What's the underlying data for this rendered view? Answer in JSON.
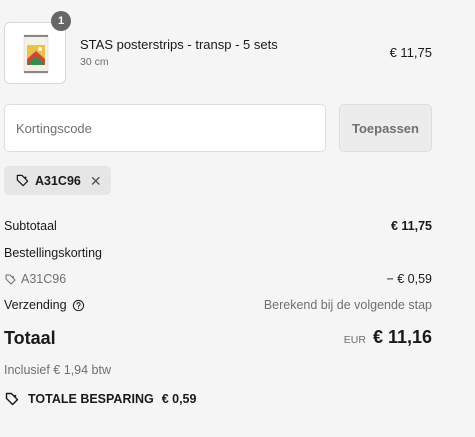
{
  "cart": {
    "item": {
      "quantity": "1",
      "name": "STAS posterstrips - transp - 5 sets",
      "variant": "30 cm",
      "price": "€ 11,75",
      "thumbnail_icon": "poster-thumbnail-icon"
    }
  },
  "discount": {
    "placeholder": "Kortingscode",
    "value": "",
    "apply_label": "Toepassen",
    "applied_code": "A31C96",
    "tag_icon": "tag-icon",
    "remove_icon": "close-icon"
  },
  "summary": {
    "subtotal_label": "Subtotaal",
    "subtotal_value": "€ 11,75",
    "order_discount_label": "Bestellingskorting",
    "order_discount_code": "A31C96",
    "order_discount_value": "− € 0,59",
    "shipping_label": "Verzending",
    "shipping_info_icon": "help-circle-icon",
    "shipping_value": "Berekend bij de volgende stap",
    "total_label": "Totaal",
    "total_currency": "EUR",
    "total_value": "€ 11,16",
    "tax_note": "Inclusief € 1,94 btw",
    "savings_label": "TOTALE BESPARING",
    "savings_value": "€ 0,59"
  },
  "colors": {
    "background": "#f5f5f5",
    "text": "#1a1a1a",
    "muted_text": "#707070",
    "badge": "#666666",
    "chip_bg": "#e6e6e6"
  }
}
